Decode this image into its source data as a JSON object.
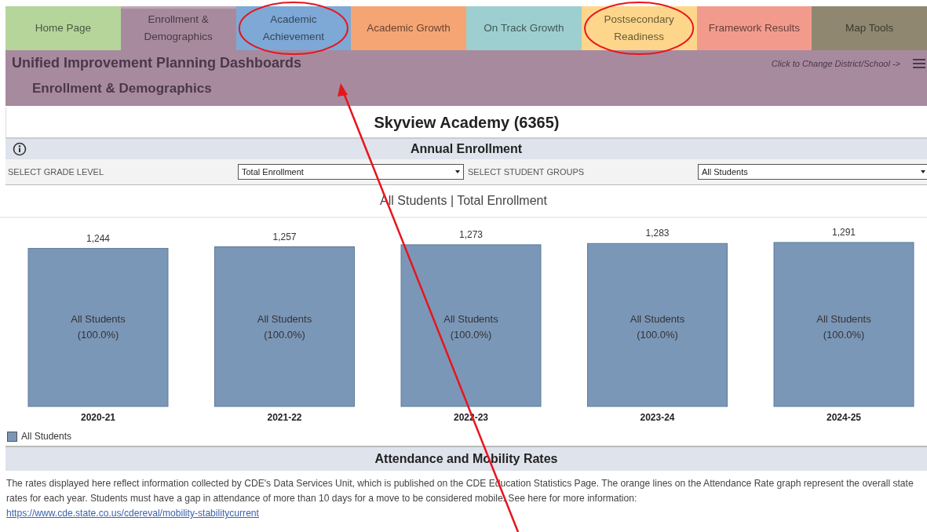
{
  "tabs": [
    {
      "label": "Home Page",
      "color": "#b5d59b",
      "selected": false,
      "circled": false
    },
    {
      "label": "Enrollment & Demographics",
      "color": "#a88a9f",
      "selected": true,
      "circled": false
    },
    {
      "label": "Academic Achievement",
      "color": "#7ea8d6",
      "selected": false,
      "circled": true
    },
    {
      "label": "Academic Growth",
      "color": "#f5a574",
      "selected": false,
      "circled": false
    },
    {
      "label": "On Track Growth",
      "color": "#9dcfd0",
      "selected": false,
      "circled": false
    },
    {
      "label": "Postsecondary Readiness",
      "color": "#fdd68b",
      "selected": false,
      "circled": true
    },
    {
      "label": "Framework Results",
      "color": "#f29b8d",
      "selected": false,
      "circled": false
    },
    {
      "label": "Map Tools",
      "color": "#8f8770",
      "selected": false,
      "circled": false
    }
  ],
  "header": {
    "title": "Unified Improvement Planning Dashboards",
    "subtitle": "Enrollment & Demographics",
    "change_link": "Click to Change District/School ->"
  },
  "annotation_arrow": true,
  "school": "Skyview Academy (6365)",
  "enrollment": {
    "title": "Annual Enrollment",
    "filters": [
      {
        "label": "SELECT GRADE LEVEL",
        "value": "Total Enrollment"
      },
      {
        "label": "SELECT STUDENT GROUPS",
        "value": "All Students"
      }
    ],
    "chart_title": "All Students | Total Enrollment",
    "bar_labels": [
      [
        "All Students",
        "(100.0%)"
      ],
      [
        "All Students",
        "(100.0%)"
      ],
      [
        "All Students",
        "(100.0%)"
      ],
      [
        "All Students",
        "(100.0%)"
      ],
      [
        "All Students",
        "(100.0%)"
      ]
    ],
    "chart_data": {
      "type": "bar",
      "categories": [
        "2020-21",
        "2021-22",
        "2022-23",
        "2023-24",
        "2024-25"
      ],
      "series": [
        {
          "name": "All Students",
          "color": "#7b97b8",
          "values": [
            1244,
            1257,
            1273,
            1283,
            1291
          ],
          "value_labels": [
            "1,244",
            "1,257",
            "1,273",
            "1,283",
            "1,291"
          ]
        }
      ],
      "data_labels": true
    }
  },
  "attendance": {
    "title": "Attendance and Mobility Rates",
    "text": "The rates displayed here reflect information collected by CDE's Data Services Unit, which is published on the CDE Education Statistics Page. The orange lines on the Attendance Rate graph represent the overall state rates for each year. Students must have a gap in attendance of more than 10 days for a move to be considered mobile. See here for more information:",
    "link": "https://www.cde.state.co.us/cdereval/mobility-stabilitycurrent"
  }
}
